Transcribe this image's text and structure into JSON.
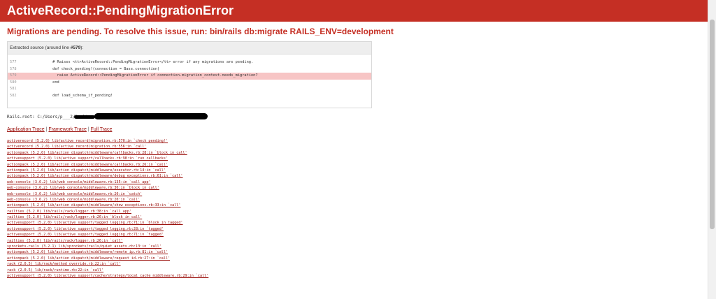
{
  "header": {
    "title": "ActiveRecord::PendingMigrationError"
  },
  "message": "Migrations are pending. To resolve this issue, run: bin/rails db:migrate RAILS_ENV=development",
  "source": {
    "title_prefix": "Extracted source (around line ",
    "line_ref": "#579",
    "title_suffix": "):",
    "lines": [
      {
        "num": "577",
        "code": "      # Raises <tt>ActiveRecord::PendingMigrationError</tt> error if any migrations are pending."
      },
      {
        "num": "578",
        "code": "      def check_pending!(connection = Base.connection)"
      },
      {
        "num": "579",
        "code": "        raise ActiveRecord::PendingMigrationError if connection.migration_context.needs_migration?"
      },
      {
        "num": "580",
        "code": "      end"
      },
      {
        "num": "581",
        "code": ""
      },
      {
        "num": "582",
        "code": "      def load_schema_if_pending!"
      }
    ]
  },
  "rails_root": "Rails.root: C:/Users/p___2/Desktop/",
  "trace_links": {
    "application": "Application Trace",
    "framework": "Framework Trace",
    "full": "Full Trace",
    "separator": " | "
  },
  "trace": [
    "activerecord (5.2.0) lib/active_record/migration.rb:570:in `check_pending!'",
    "activerecord (5.2.0) lib/active_record/migration.rb:556:in `call'",
    "actionpack (5.2.0) lib/action_dispatch/middleware/callbacks.rb:28:in `block in call'",
    "activesupport (5.2.0) lib/active_support/callbacks.rb:98:in `run_callbacks'",
    "actionpack (5.2.0) lib/action_dispatch/middleware/callbacks.rb:26:in `call'",
    "actionpack (5.2.0) lib/action_dispatch/middleware/executor.rb:14:in `call'",
    "actionpack (5.2.0) lib/action_dispatch/middleware/debug_exceptions.rb:61:in `call'",
    "web-console (3.6.2) lib/web_console/middleware.rb:135:in `call_app'",
    "web-console (3.6.2) lib/web_console/middleware.rb:30:in `block in call'",
    "web-console (3.6.2) lib/web_console/middleware.rb:20:in `catch'",
    "web-console (3.6.2) lib/web_console/middleware.rb:20:in `call'",
    "actionpack (5.2.0) lib/action_dispatch/middleware/show_exceptions.rb:33:in `call'",
    "railties (5.2.0) lib/rails/rack/logger.rb:38:in `call_app'",
    "railties (5.2.0) lib/rails/rack/logger.rb:26:in `block in call'",
    "activesupport (5.2.0) lib/active_support/tagged_logging.rb:71:in `block in tagged'",
    "activesupport (5.2.0) lib/active_support/tagged_logging.rb:28:in `tagged'",
    "activesupport (5.2.0) lib/active_support/tagged_logging.rb:71:in `tagged'",
    "railties (5.2.0) lib/rails/rack/logger.rb:26:in `call'",
    "sprockets-rails (3.2.1) lib/sprockets/rails/quiet_assets.rb:13:in `call'",
    "actionpack (5.2.0) lib/action_dispatch/middleware/remote_ip.rb:81:in `call'",
    "actionpack (5.2.0) lib/action_dispatch/middleware/request_id.rb:27:in `call'",
    "rack (2.0.5) lib/rack/method_override.rb:22:in `call'",
    "rack (2.0.5) lib/rack/runtime.rb:22:in `call'",
    "activesupport (5.2.0) lib/active_support/cache/strategy/local_cache_middleware.rb:29:in `call'"
  ]
}
